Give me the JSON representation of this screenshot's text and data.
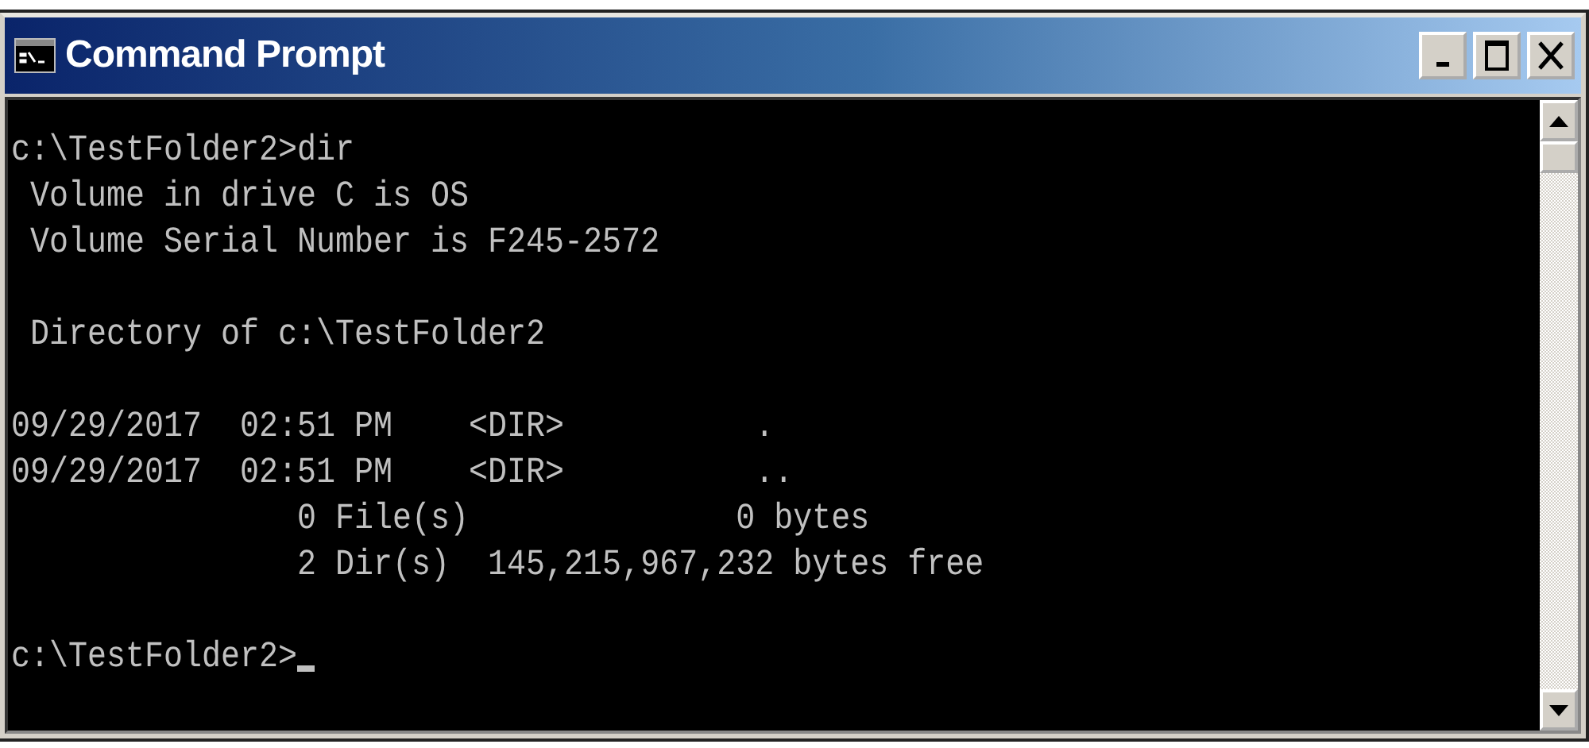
{
  "window": {
    "title": "Command Prompt"
  },
  "console": {
    "lines": [
      {
        "kind": "output",
        "text": "c:\\TestFolder2>dir"
      },
      {
        "kind": "output",
        "text": " Volume in drive C is OS"
      },
      {
        "kind": "output",
        "text": " Volume Serial Number is F245-2572"
      },
      {
        "kind": "blank"
      },
      {
        "kind": "output",
        "text": " Directory of c:\\TestFolder2"
      },
      {
        "kind": "blank"
      },
      {
        "kind": "output",
        "text": "09/29/2017  02:51 PM    <DIR>          ."
      },
      {
        "kind": "output",
        "text": "09/29/2017  02:51 PM    <DIR>          .."
      },
      {
        "kind": "output",
        "text": "               0 File(s)              0 bytes"
      },
      {
        "kind": "output",
        "text": "               2 Dir(s)  145,215,967,232 bytes free"
      },
      {
        "kind": "blank"
      },
      {
        "kind": "prompt",
        "text": "c:\\TestFolder2>",
        "cursor": true
      }
    ]
  }
}
